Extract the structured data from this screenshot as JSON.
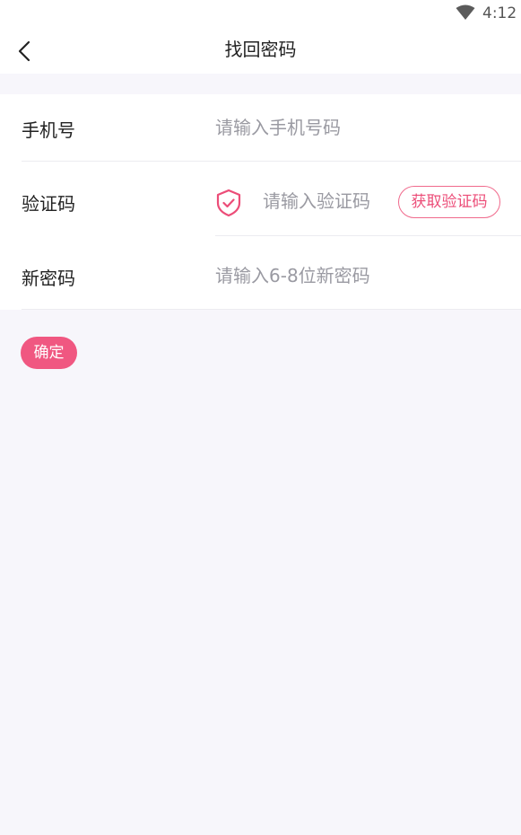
{
  "status_bar": {
    "time": "4:12",
    "wifi_icon": "wifi-icon"
  },
  "header": {
    "title": "找回密码",
    "back_icon": "chevron-left-icon"
  },
  "form": {
    "phone": {
      "label": "手机号",
      "placeholder": "请输入手机号码",
      "value": ""
    },
    "code": {
      "label": "验证码",
      "placeholder": "请输入验证码",
      "value": "",
      "icon": "shield-check-icon",
      "get_code_label": "获取验证码"
    },
    "password": {
      "label": "新密码",
      "placeholder": "请输入6-8位新密码",
      "value": ""
    }
  },
  "confirm_label": "确定",
  "colors": {
    "accent": "#f05781",
    "accent_text": "#ec4d78",
    "background": "#f7f6fb",
    "placeholder": "#9a9aa2"
  }
}
